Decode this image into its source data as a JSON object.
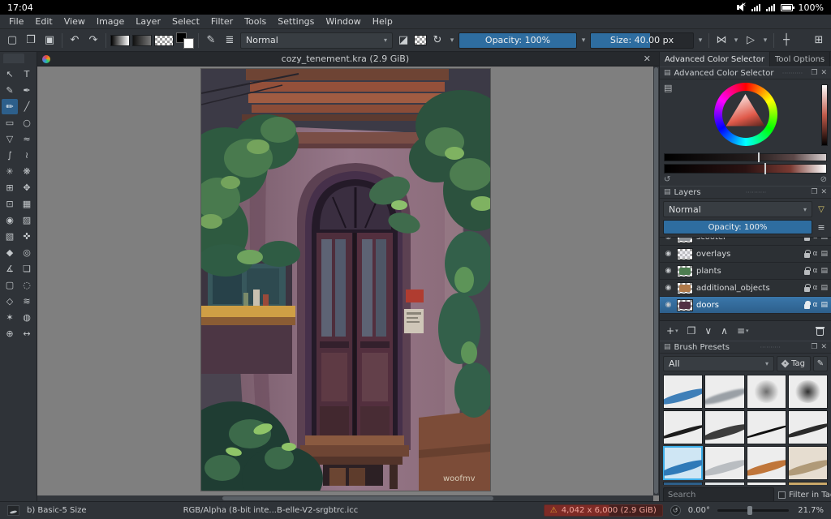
{
  "android_bar": {
    "time": "17:04",
    "battery": "100%"
  },
  "menu_bar": {
    "items": [
      "File",
      "Edit",
      "View",
      "Image",
      "Layer",
      "Select",
      "Filter",
      "Tools",
      "Settings",
      "Window",
      "Help"
    ]
  },
  "toolbar": {
    "blend_mode": "Normal",
    "opacity": "Opacity: 100%",
    "size": "Size: 40.00 px",
    "icons": {
      "new": "▢",
      "open": "❒",
      "save": "▣",
      "undo": "↶",
      "redo": "↷",
      "brush_editor": "✎",
      "lines": "≣",
      "eraser": "◪",
      "reload": "↻",
      "mirror_h": "⋈",
      "mirror_v": "▷",
      "snap": "┼",
      "workspace": "⊞",
      "caret": "▾"
    }
  },
  "document": {
    "tab_title": "cozy_tenement.kra (2.9 GiB)"
  },
  "toolbox": {
    "tools": [
      {
        "name": "select-shapes",
        "glyph": "↖"
      },
      {
        "name": "text",
        "glyph": "T"
      },
      {
        "name": "edit-shapes",
        "glyph": "✎"
      },
      {
        "name": "calligraphy",
        "glyph": "✒"
      },
      {
        "name": "freehand-brush",
        "glyph": "✏"
      },
      {
        "name": "line",
        "glyph": "╱"
      },
      {
        "name": "rectangle",
        "glyph": "▭"
      },
      {
        "name": "ellipse",
        "glyph": "○"
      },
      {
        "name": "polygon",
        "glyph": "▽"
      },
      {
        "name": "polyline",
        "glyph": "≈"
      },
      {
        "name": "bezier-path",
        "glyph": "∫"
      },
      {
        "name": "freehand-path",
        "glyph": "≀"
      },
      {
        "name": "dynamic-brush",
        "glyph": "✳"
      },
      {
        "name": "multibrush",
        "glyph": "❋"
      },
      {
        "name": "transform",
        "glyph": "⊞"
      },
      {
        "name": "move",
        "glyph": "✥"
      },
      {
        "name": "crop",
        "glyph": "⊡"
      },
      {
        "name": "gradient",
        "glyph": "▦"
      },
      {
        "name": "color-sampler",
        "glyph": "◉"
      },
      {
        "name": "pattern-edit",
        "glyph": "▨"
      },
      {
        "name": "colorize-mask",
        "glyph": "▧"
      },
      {
        "name": "smart-patch",
        "glyph": "✜"
      },
      {
        "name": "fill",
        "glyph": "◆"
      },
      {
        "name": "enclose-fill",
        "glyph": "◎"
      },
      {
        "name": "measure",
        "glyph": "∡"
      },
      {
        "name": "reference-images",
        "glyph": "❏"
      },
      {
        "name": "rect-select",
        "glyph": "▢"
      },
      {
        "name": "ellipse-select",
        "glyph": "◌"
      },
      {
        "name": "polygon-select",
        "glyph": "◇"
      },
      {
        "name": "freehand-select",
        "glyph": "≋"
      },
      {
        "name": "contiguous-select",
        "glyph": "✶"
      },
      {
        "name": "similar-select",
        "glyph": "◍"
      },
      {
        "name": "zoom",
        "glyph": "⊕"
      },
      {
        "name": "pan",
        "glyph": "↔"
      }
    ]
  },
  "right_panel": {
    "tab_color_selector": "Advanced Color Selector",
    "tab_tool_options": "Tool Options",
    "color_selector": {
      "title": "Advanced Color Selector"
    },
    "layers": {
      "title": "Layers",
      "blend_mode": "Normal",
      "opacity": "Opacity: 100%",
      "items": [
        {
          "name": "scooter"
        },
        {
          "name": "overlays"
        },
        {
          "name": "plants"
        },
        {
          "name": "additional_objects"
        },
        {
          "name": "doors"
        }
      ]
    },
    "brush_presets": {
      "title": "Brush Presets",
      "filter_value": "All",
      "tag_label": "Tag",
      "search_placeholder": "Search",
      "filter_in_tag_label": "Filter in Tag"
    }
  },
  "status_bar": {
    "brush_name": "b) Basic-5 Size",
    "color_profile": "RGB/Alpha (8-bit inte...B-elle-V2-srgbtrc.icc",
    "canvas_info": "4,042 x 6,000 (2.9 GiB)",
    "rotation": "0.00°",
    "zoom": "21.7%"
  },
  "painting": {
    "signature": "woofmv"
  },
  "colors": {
    "accent": "#3daee9",
    "slider_fill": "#2e6da0",
    "selected_layer": "#2d5f8b",
    "canvas_bg": "#7f7f7f",
    "warning_red": "#e0655a"
  },
  "glyphs": {
    "eye": "◉",
    "alpha": "α",
    "close": "✕",
    "float": "❐",
    "dots": "··········",
    "caret_down": "▾",
    "plus": "+",
    "duplicate": "❐",
    "move_down": "∨",
    "move_up": "∧",
    "properties": "≡",
    "funnel": "▽",
    "menu": "≡",
    "pencil": "✎",
    "warning": "⚠",
    "refresh": "↺",
    "block": "⊘",
    "grid": "▤",
    "reset": "↺"
  }
}
